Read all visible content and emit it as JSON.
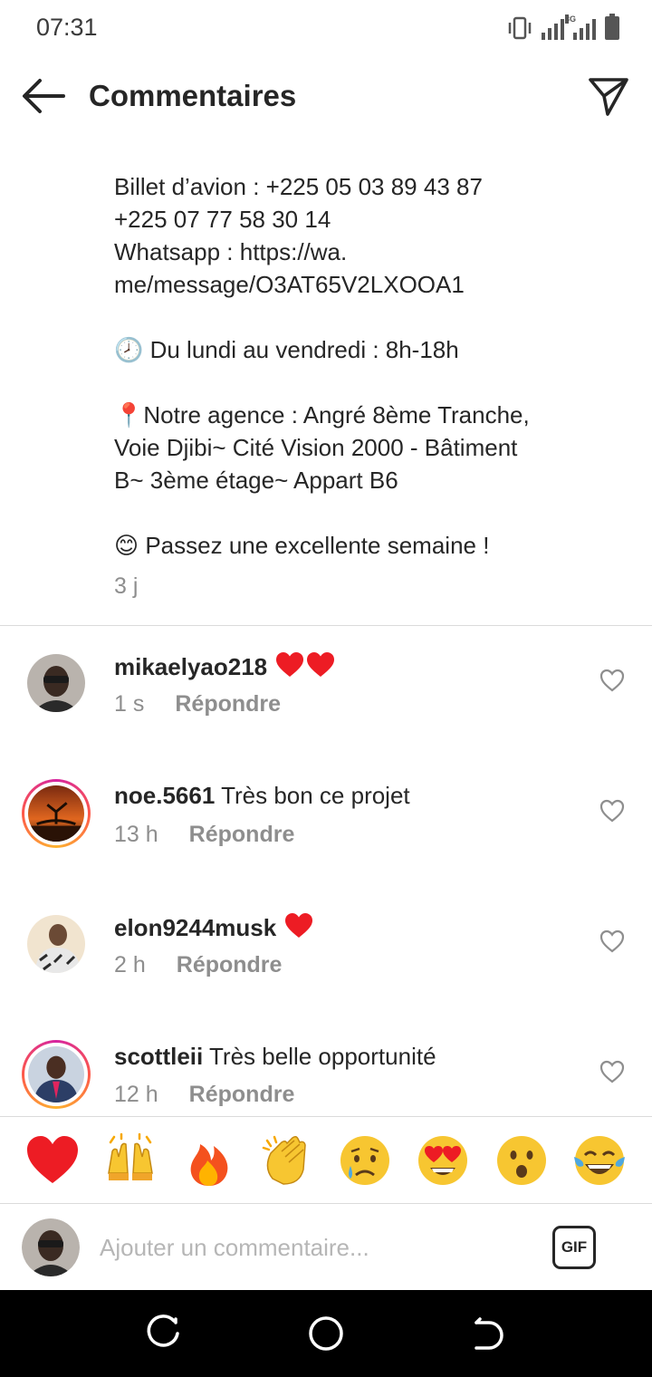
{
  "status": {
    "time": "07:31",
    "network": "3G"
  },
  "header": {
    "title": "Commentaires"
  },
  "caption": {
    "text": "Billet d’avion : +225 05 03 89 43 87\n+225 07 77 58 30 14\nWhatsapp : https://wa.\nme/message/O3AT65V2LXOOA1\n\n🕗 Du lundi au vendredi : 8h-18h\n\n📍Notre agence : Angré 8ème Tranche,\nVoie Djibi~ Cité Vision 2000 - Bâtiment\nB~ 3ème étage~ Appart B6\n\n😊 Passez une excellente semaine !",
    "time": "3 j"
  },
  "comments": [
    {
      "user": "mikaelyao218",
      "text": "",
      "hearts": 2,
      "time": "1 s",
      "reply": "Répondre",
      "story": false
    },
    {
      "user": "noe.5661",
      "text": "Très bon ce projet",
      "hearts": 0,
      "time": "13 h",
      "reply": "Répondre",
      "story": true
    },
    {
      "user": "elon9244musk",
      "text": "",
      "hearts": 1,
      "time": "2 h",
      "reply": "Répondre",
      "story": false
    },
    {
      "user": "scottleii",
      "text": "Très belle opportunité",
      "hearts": 0,
      "time": "12 h",
      "reply": "Répondre",
      "story": true
    }
  ],
  "emoji_bar": [
    "red-heart",
    "raising-hands",
    "fire",
    "clapping-hands",
    "sad-face",
    "heart-eyes-face",
    "surprised-face",
    "tears-of-joy-face"
  ],
  "composer": {
    "placeholder": "Ajouter un commentaire...",
    "gif_label": "GIF"
  },
  "colors": {
    "secondary_text": "#8e8e8e",
    "heart": "#ed1c24",
    "divider": "#dbdbdb"
  }
}
